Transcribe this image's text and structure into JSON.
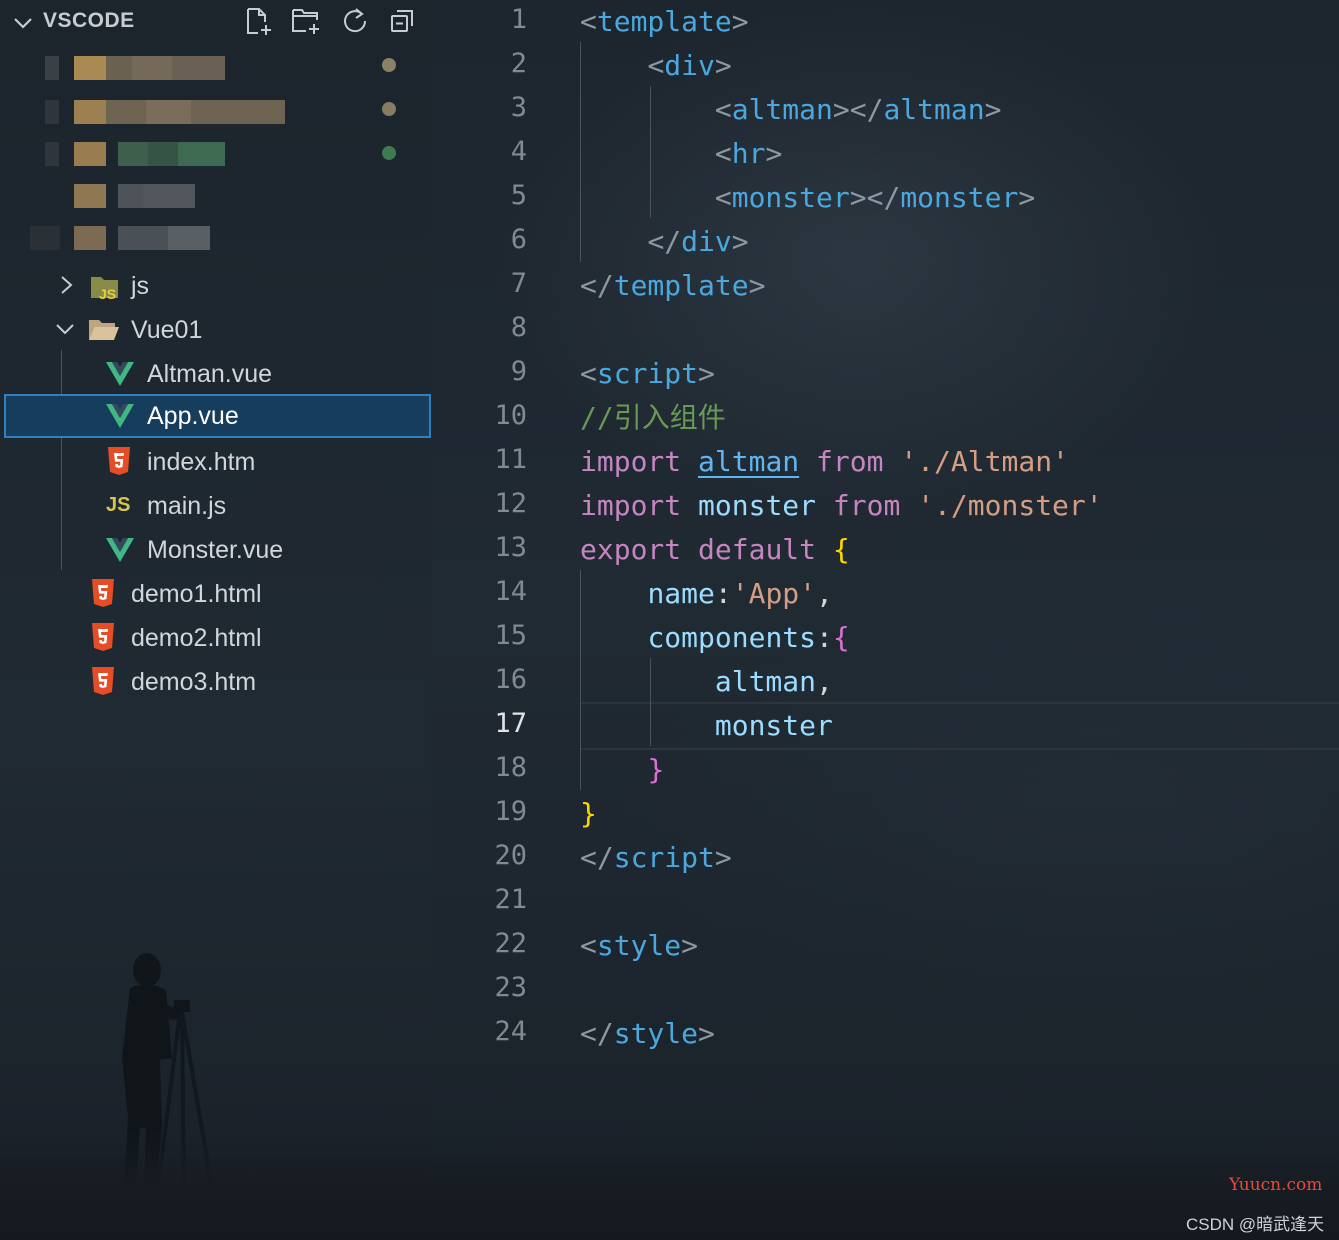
{
  "explorer": {
    "title": "VSCODE",
    "toolbar_icons": [
      "new-file-icon",
      "new-folder-icon",
      "refresh-icon",
      "collapse-all-icon"
    ],
    "tree": [
      {
        "label": "js",
        "type": "folder",
        "state": "collapsed",
        "icon": "js-folder-icon"
      },
      {
        "label": "Vue01",
        "type": "folder",
        "state": "expanded",
        "icon": "folder-open-icon"
      },
      {
        "label": "Altman.vue",
        "type": "file",
        "icon": "vue-icon"
      },
      {
        "label": "App.vue",
        "type": "file",
        "icon": "vue-icon",
        "selected": true
      },
      {
        "label": "index.htm",
        "type": "file",
        "icon": "html5-icon"
      },
      {
        "label": "main.js",
        "type": "file",
        "icon": "js-icon",
        "badge": "JS"
      },
      {
        "label": "Monster.vue",
        "type": "file",
        "icon": "vue-icon"
      },
      {
        "label": "demo1.html",
        "type": "file",
        "icon": "html5-icon"
      },
      {
        "label": "demo2.html",
        "type": "file",
        "icon": "html5-icon"
      },
      {
        "label": "demo3.htm",
        "type": "file",
        "icon": "html5-icon"
      }
    ]
  },
  "editor": {
    "active_line": "17",
    "line_numbers": [
      "1",
      "2",
      "3",
      "4",
      "5",
      "6",
      "7",
      "8",
      "9",
      "10",
      "11",
      "12",
      "13",
      "14",
      "15",
      "16",
      "17",
      "18",
      "19",
      "20",
      "21",
      "22",
      "23",
      "24"
    ],
    "lines": [
      [
        [
          "<",
          "punc"
        ],
        [
          "template",
          "tag"
        ],
        [
          ">",
          "punc"
        ]
      ],
      [
        [
          "    ",
          "plain"
        ],
        [
          "<",
          "punc"
        ],
        [
          "div",
          "tag"
        ],
        [
          ">",
          "punc"
        ]
      ],
      [
        [
          "        ",
          "plain"
        ],
        [
          "<",
          "punc"
        ],
        [
          "altman",
          "tag"
        ],
        [
          "></",
          "punc"
        ],
        [
          "altman",
          "tag"
        ],
        [
          ">",
          "punc"
        ]
      ],
      [
        [
          "        ",
          "plain"
        ],
        [
          "<",
          "punc"
        ],
        [
          "hr",
          "tag"
        ],
        [
          ">",
          "punc"
        ]
      ],
      [
        [
          "        ",
          "plain"
        ],
        [
          "<",
          "punc"
        ],
        [
          "monster",
          "tag"
        ],
        [
          "></",
          "punc"
        ],
        [
          "monster",
          "tag"
        ],
        [
          ">",
          "punc"
        ]
      ],
      [
        [
          "    ",
          "plain"
        ],
        [
          "</",
          "punc"
        ],
        [
          "div",
          "tag"
        ],
        [
          ">",
          "punc"
        ]
      ],
      [
        [
          "</",
          "punc"
        ],
        [
          "template",
          "tag"
        ],
        [
          ">",
          "punc"
        ]
      ],
      [],
      [
        [
          "<",
          "punc"
        ],
        [
          "script",
          "tag"
        ],
        [
          ">",
          "punc"
        ]
      ],
      [
        [
          "//引入组件",
          "comment"
        ]
      ],
      [
        [
          "import",
          "kw"
        ],
        [
          " ",
          "plain"
        ],
        [
          "altman",
          "id-u"
        ],
        [
          " ",
          "plain"
        ],
        [
          "from",
          "kw"
        ],
        [
          " ",
          "plain"
        ],
        [
          "'./Altman'",
          "str"
        ]
      ],
      [
        [
          "import",
          "kw"
        ],
        [
          " ",
          "plain"
        ],
        [
          "monster",
          "id"
        ],
        [
          " ",
          "plain"
        ],
        [
          "from",
          "kw"
        ],
        [
          " ",
          "plain"
        ],
        [
          "'./monster'",
          "str"
        ]
      ],
      [
        [
          "export",
          "kw"
        ],
        [
          " ",
          "plain"
        ],
        [
          "default",
          "kw"
        ],
        [
          " ",
          "plain"
        ],
        [
          "{",
          "brace1"
        ]
      ],
      [
        [
          "    ",
          "plain"
        ],
        [
          "name",
          "id"
        ],
        [
          ":",
          "plain"
        ],
        [
          "'App'",
          "str"
        ],
        [
          ",",
          "plain"
        ]
      ],
      [
        [
          "    ",
          "plain"
        ],
        [
          "components",
          "id"
        ],
        [
          ":",
          "plain"
        ],
        [
          "{",
          "brace2"
        ]
      ],
      [
        [
          "        ",
          "plain"
        ],
        [
          "altman",
          "id"
        ],
        [
          ",",
          "plain"
        ]
      ],
      [
        [
          "        ",
          "plain"
        ],
        [
          "monster",
          "id"
        ]
      ],
      [
        [
          "    ",
          "plain"
        ],
        [
          "}",
          "brace2"
        ]
      ],
      [
        [
          "}",
          "brace1"
        ]
      ],
      [
        [
          "</",
          "punc"
        ],
        [
          "script",
          "tag"
        ],
        [
          ">",
          "punc"
        ]
      ],
      [],
      [
        [
          "<",
          "punc"
        ],
        [
          "style",
          "tag"
        ],
        [
          ">",
          "punc"
        ]
      ],
      [],
      [
        [
          "</",
          "punc"
        ],
        [
          "style",
          "tag"
        ],
        [
          ">",
          "punc"
        ]
      ]
    ]
  },
  "watermarks": {
    "site": "Yuucn.com",
    "author": "CSDN @暗武逢天"
  }
}
